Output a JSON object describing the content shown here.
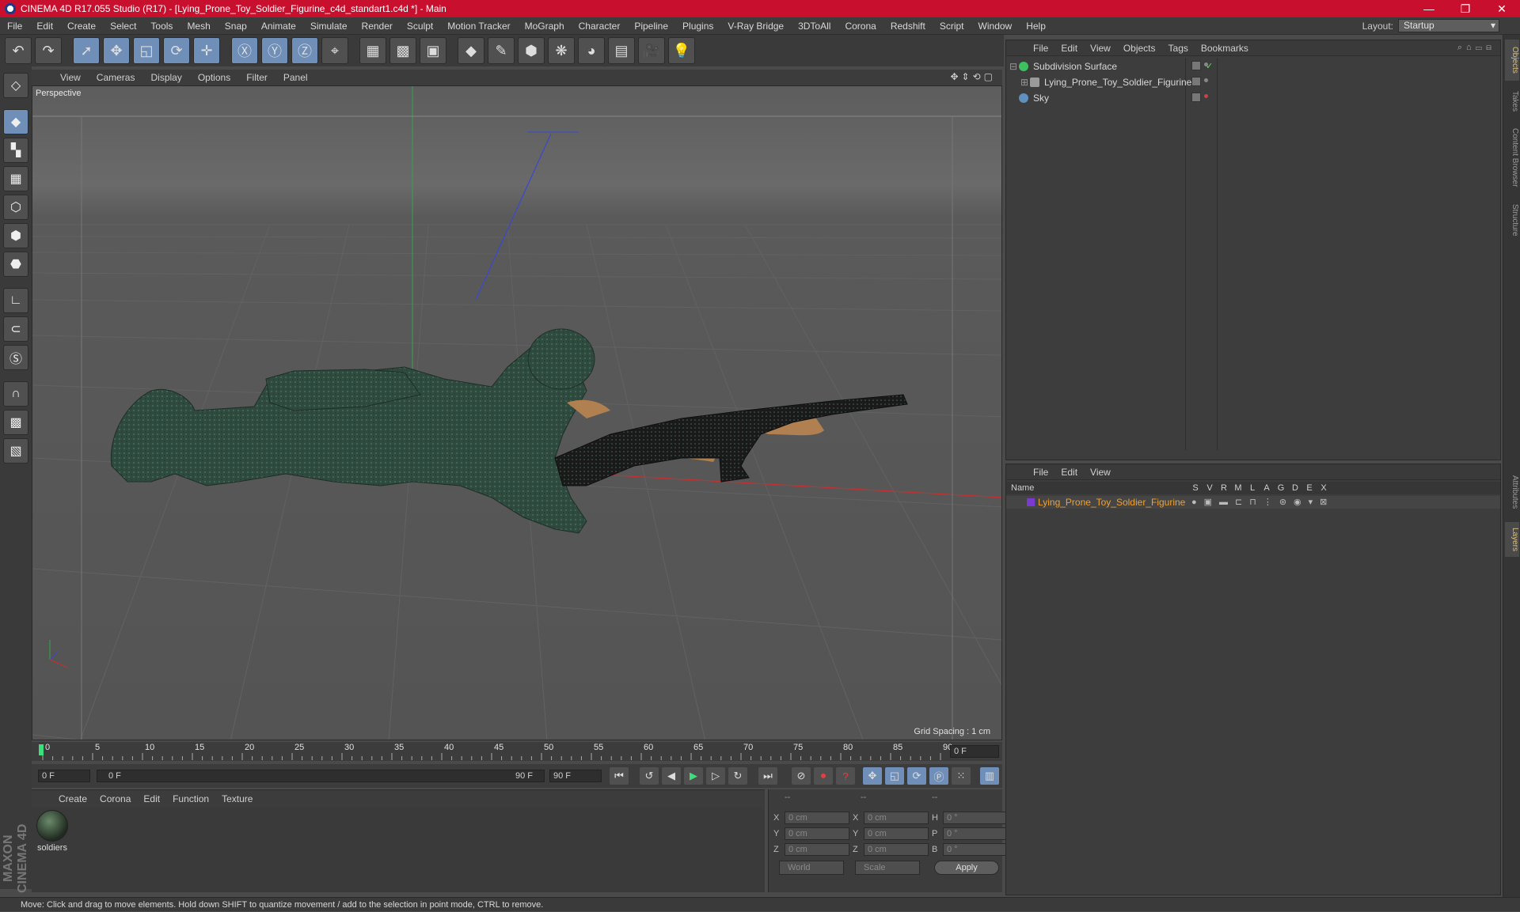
{
  "window": {
    "title": "CINEMA 4D R17.055 Studio (R17) - [Lying_Prone_Toy_Soldier_Figurine_c4d_standart1.c4d *] - Main",
    "minimize": "—",
    "restore": "❐",
    "close": "✕"
  },
  "menu": [
    "File",
    "Edit",
    "Create",
    "Select",
    "Tools",
    "Mesh",
    "Snap",
    "Animate",
    "Simulate",
    "Render",
    "Sculpt",
    "Motion Tracker",
    "MoGraph",
    "Character",
    "Pipeline",
    "Plugins",
    "V-Ray Bridge",
    "3DToAll",
    "Corona",
    "Redshift",
    "Script",
    "Window",
    "Help"
  ],
  "layout": {
    "label": "Layout:",
    "value": "Startup"
  },
  "viewport": {
    "menu": [
      "View",
      "Cameras",
      "Display",
      "Options",
      "Filter",
      "Panel"
    ],
    "label": "Perspective",
    "grid_spacing": "Grid Spacing : 1 cm"
  },
  "timeline": {
    "ticks": [
      "0",
      "5",
      "10",
      "15",
      "20",
      "25",
      "30",
      "35",
      "40",
      "45",
      "50",
      "55",
      "60",
      "65",
      "70",
      "75",
      "80",
      "85",
      "90"
    ],
    "current_frame": "0 F",
    "start": "0 F",
    "range_start": "0 F",
    "range_end": "90 F",
    "end": "90 F"
  },
  "material_manager": {
    "menu": [
      "Create",
      "Corona",
      "Edit",
      "Function",
      "Texture"
    ],
    "materials": [
      {
        "name": "soldiers"
      }
    ]
  },
  "coordinates": {
    "headers": [
      "--",
      "--",
      "--"
    ],
    "rows": [
      {
        "a_label": "X",
        "a_value": "0 cm",
        "b_label": "X",
        "b_value": "0 cm",
        "c_label": "H",
        "c_value": "0 °"
      },
      {
        "a_label": "Y",
        "a_value": "0 cm",
        "b_label": "Y",
        "b_value": "0 cm",
        "c_label": "P",
        "c_value": "0 °"
      },
      {
        "a_label": "Z",
        "a_value": "0 cm",
        "b_label": "Z",
        "b_value": "0 cm",
        "c_label": "B",
        "c_value": "0 °"
      }
    ],
    "mode": "World",
    "scale": "Scale",
    "apply": "Apply"
  },
  "object_manager": {
    "menu": [
      "File",
      "Edit",
      "View",
      "Objects",
      "Tags",
      "Bookmarks"
    ],
    "objects": [
      {
        "name": "Subdivision Surface",
        "color": "#3cc060"
      },
      {
        "name": "Lying_Prone_Toy_Soldier_Figurine",
        "color": "#9a9a9a"
      },
      {
        "name": "Sky",
        "color": "#6090c0"
      }
    ]
  },
  "layer_manager": {
    "menu": [
      "File",
      "Edit",
      "View"
    ],
    "name_header": "Name",
    "columns": [
      "S",
      "V",
      "R",
      "M",
      "L",
      "A",
      "G",
      "D",
      "E",
      "X"
    ],
    "layers": [
      {
        "name": "Lying_Prone_Toy_Soldier_Figurine",
        "color": "#7a3ad0"
      }
    ]
  },
  "right_tabs": [
    "Objects",
    "Takes",
    "Content Browser",
    "Structure",
    "Attributes",
    "Layers"
  ],
  "brand": "MAXON CINEMA 4D",
  "status": "Move: Click and drag to move elements. Hold down SHIFT to quantize movement / add to the selection in point mode, CTRL to remove."
}
